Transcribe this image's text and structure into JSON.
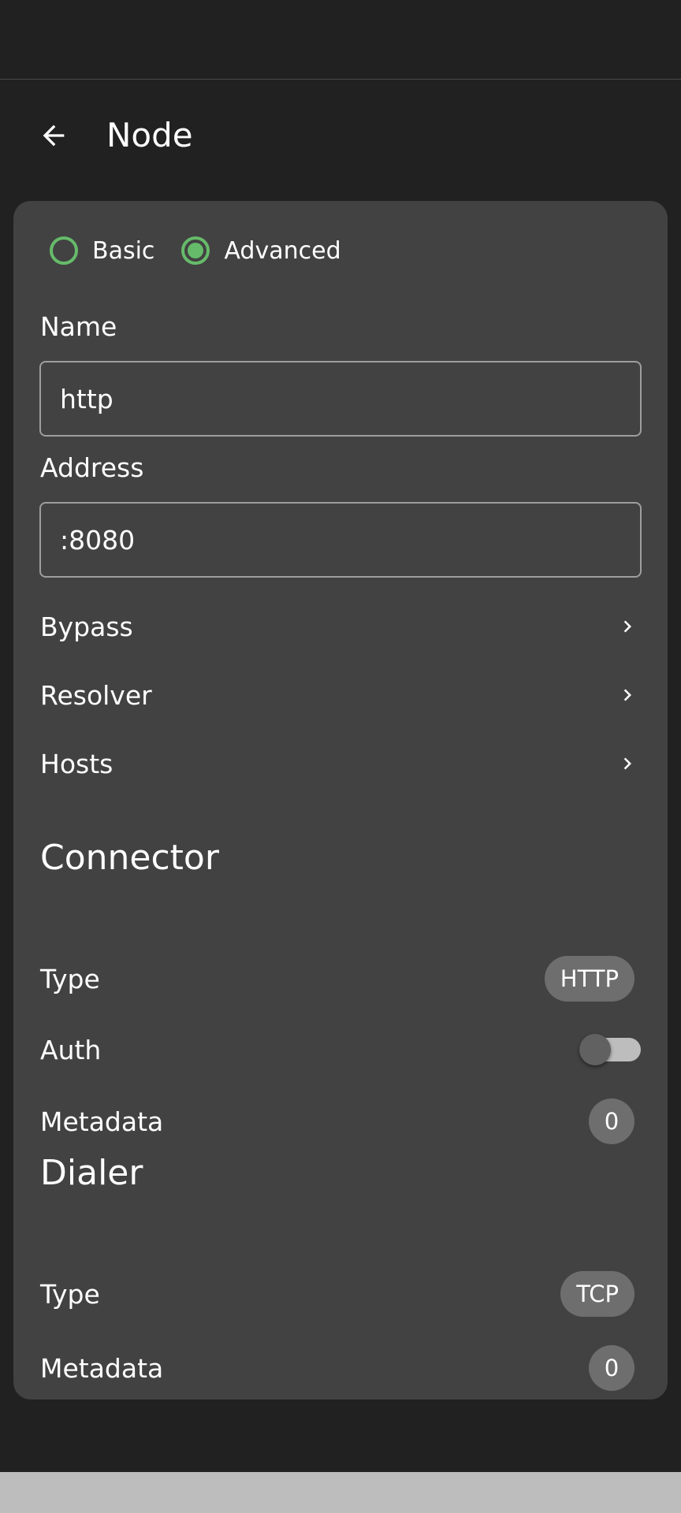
{
  "header": {
    "title": "Node",
    "back_icon": "arrow-back-icon"
  },
  "mode": {
    "options": [
      {
        "label": "Basic",
        "selected": false
      },
      {
        "label": "Advanced",
        "selected": true
      }
    ]
  },
  "form": {
    "name_label": "Name",
    "name_value": "http",
    "address_label": "Address",
    "address_value": ":8080"
  },
  "nav_items": [
    {
      "label": "Bypass",
      "icon": "chevron-right-icon"
    },
    {
      "label": "Resolver",
      "icon": "chevron-right-icon"
    },
    {
      "label": "Hosts",
      "icon": "chevron-right-icon"
    }
  ],
  "connector": {
    "title": "Connector",
    "type_label": "Type",
    "type_value": "HTTP",
    "auth_label": "Auth",
    "auth_enabled": false,
    "metadata_label": "Metadata",
    "metadata_count": "0"
  },
  "dialer": {
    "title": "Dialer",
    "type_label": "Type",
    "type_value": "TCP",
    "metadata_label": "Metadata",
    "metadata_count": "0"
  },
  "colors": {
    "background": "#212121",
    "card": "#424242",
    "accent": "#66bb6a",
    "chip": "#6e6e6e"
  }
}
